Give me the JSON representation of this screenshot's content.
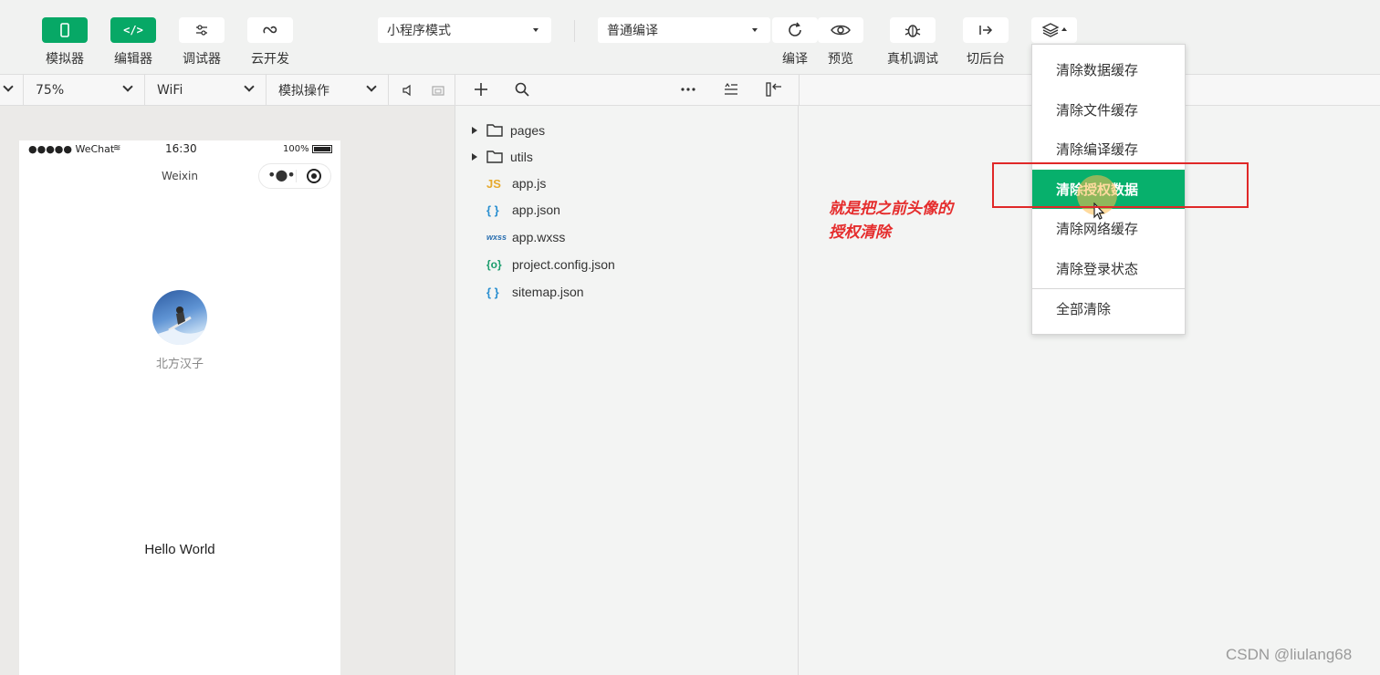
{
  "toolbar": {
    "simulator_label": "模拟器",
    "editor_label": "编辑器",
    "debugger_label": "调试器",
    "cloud_label": "云开发",
    "mode_select": "小程序模式",
    "compile_select": "普通编译",
    "compile_label": "编译",
    "preview_label": "预览",
    "real_debug_label": "真机调试",
    "background_label": "切后台"
  },
  "sim_bar": {
    "zoom": "75%",
    "network": "WiFi",
    "operation": "模拟操作"
  },
  "phone": {
    "carrier": "●●●●● WeChat",
    "time": "16:30",
    "battery": "100%",
    "nav_title": "Weixin",
    "nickname": "北方汉子",
    "hello": "Hello World"
  },
  "explorer": {
    "items": [
      {
        "name": "pages",
        "icon": "folder-icon",
        "type": "folder"
      },
      {
        "name": "utils",
        "icon": "folder-icon",
        "type": "folder"
      },
      {
        "name": "app.js",
        "icon": "js-file-icon",
        "type": "file",
        "badge": "JS"
      },
      {
        "name": "app.json",
        "icon": "json-file-icon",
        "type": "file",
        "badge": "{ }"
      },
      {
        "name": "app.wxss",
        "icon": "wxss-file-icon",
        "type": "file",
        "badge": "wxss"
      },
      {
        "name": "project.config.json",
        "icon": "config-file-icon",
        "type": "file",
        "badge": "{o}"
      },
      {
        "name": "sitemap.json",
        "icon": "json-file-icon",
        "type": "file",
        "badge": "{ }"
      }
    ]
  },
  "menu": {
    "items": [
      "清除数据缓存",
      "清除文件缓存",
      "清除编译缓存",
      "清除授权数据",
      "清除网络缓存",
      "清除登录状态",
      "全部清除"
    ],
    "active_index": 3
  },
  "annotation": {
    "line1": "就是把之前头像的",
    "line2": "授权清除"
  },
  "watermark": "CSDN @liulang68",
  "colors": {
    "accent": "#07b06c",
    "annotation": "#e52d2d"
  }
}
